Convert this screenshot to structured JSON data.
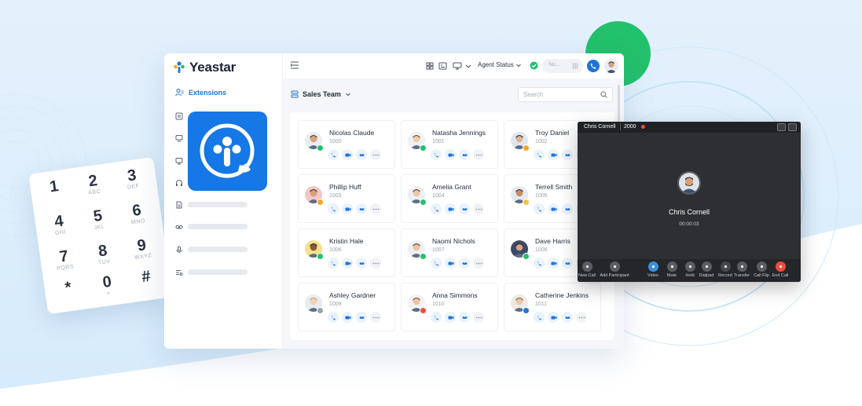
{
  "brand": {
    "name": "Yeastar"
  },
  "keypad": {
    "keys": [
      {
        "digit": "1",
        "letters": ""
      },
      {
        "digit": "2",
        "letters": "ABC"
      },
      {
        "digit": "3",
        "letters": "DEF"
      },
      {
        "digit": "4",
        "letters": "GHI"
      },
      {
        "digit": "5",
        "letters": "JKL"
      },
      {
        "digit": "6",
        "letters": "MNO"
      },
      {
        "digit": "7",
        "letters": "PQRS"
      },
      {
        "digit": "8",
        "letters": "TUV"
      },
      {
        "digit": "9",
        "letters": "WXYZ"
      },
      {
        "digit": "*",
        "letters": ""
      },
      {
        "digit": "0",
        "letters": "+"
      },
      {
        "digit": "#",
        "letters": ""
      }
    ]
  },
  "sidebar": {
    "active_label": "Extensions",
    "icons": [
      "contacts-icon",
      "monitor-icon",
      "display-icon",
      "headset-icon",
      "document-icon",
      "voicemail-icon",
      "microphone-icon",
      "list-settings-icon"
    ]
  },
  "topbar": {
    "agent_status": "Agent Status",
    "number_placeholder": "Nu..."
  },
  "main": {
    "team": "Sales Team",
    "search_placeholder": "Search",
    "contacts": [
      {
        "name": "Nicolas Claude",
        "ext": "1000",
        "status": "#22c16b",
        "skin": "#d8a47e",
        "hair": "#4a3424",
        "bg": "#e9eef5"
      },
      {
        "name": "Natasha Jennings",
        "ext": "1001",
        "status": "#22c16b",
        "skin": "#f0c9a8",
        "hair": "#6b4a33",
        "bg": "#eef1f4"
      },
      {
        "name": "Troy Daniel",
        "ext": "1002",
        "status": "#f5a623",
        "skin": "#e2b08c",
        "hair": "#2f2a26",
        "bg": "#dde6f0"
      },
      {
        "name": "Phillip Huff",
        "ext": "1003",
        "status": "#f5a623",
        "skin": "#d7a07c",
        "hair": "#3a2a20",
        "bg": "#f3c7c7"
      },
      {
        "name": "Amelia Grant",
        "ext": "1004",
        "status": "#22c16b",
        "skin": "#efc4a4",
        "hair": "#5a3a26",
        "bg": "#eceff3"
      },
      {
        "name": "Terrell Smith",
        "ext": "1005",
        "status": "#f5c242",
        "skin": "#c98e66",
        "hair": "#2e2520",
        "bg": "#e4eaf1"
      },
      {
        "name": "Kristin Hale",
        "ext": "1006",
        "status": "#22c16b",
        "skin": "#8a5a3c",
        "hair": "#2a1b14",
        "bg": "#f6e08a"
      },
      {
        "name": "Naomi Nichols",
        "ext": "1007",
        "status": "#22c16b",
        "skin": "#eec2a0",
        "hair": "#5b3a28",
        "bg": "#eef0f3"
      },
      {
        "name": "Dave Harris",
        "ext": "1008",
        "status": "#22c16b",
        "skin": "#d9a582",
        "hair": "#332820",
        "bg": "#3b4a66"
      },
      {
        "name": "Ashley Gardner",
        "ext": "1009",
        "status": "#9aa3ad",
        "skin": "#f1d1b7",
        "hair": "#c99a5c",
        "bg": "#e6ecf2"
      },
      {
        "name": "Anna Simmons",
        "ext": "1010",
        "status": "#ef4b3f",
        "skin": "#efc3a4",
        "hair": "#6a4430",
        "bg": "#f0f2f4"
      },
      {
        "name": "Catherine Jenkins",
        "ext": "1011",
        "status": "#1e74d6",
        "skin": "#eec6a8",
        "hair": "#7a5234",
        "bg": "#ede9e4"
      }
    ]
  },
  "call_window": {
    "caller": "Chris Cornell",
    "number": "2000",
    "timer": "00:00:03",
    "controls": [
      {
        "label": "New Call",
        "icon": "plus-icon",
        "color": "#5a5d62"
      },
      {
        "label": "Add Participant",
        "icon": "add-participant-icon",
        "color": "#5a5d62"
      },
      {
        "label": "Video",
        "icon": "video-icon",
        "color": "#3c8fe0"
      },
      {
        "label": "Mute",
        "icon": "mute-icon",
        "color": "#5a5d62"
      },
      {
        "label": "Hold",
        "icon": "hold-icon",
        "color": "#5a5d62"
      },
      {
        "label": "Dialpad",
        "icon": "dialpad-icon",
        "color": "#5a5d62"
      },
      {
        "label": "Record",
        "icon": "record-icon",
        "color": "#45484d"
      },
      {
        "label": "Transfer",
        "icon": "transfer-icon",
        "color": "#5a5d62"
      },
      {
        "label": "Call Flip",
        "icon": "call-flip-icon",
        "color": "#5a5d62"
      },
      {
        "label": "End Call",
        "icon": "end-call-icon",
        "color": "#ef4b3f"
      }
    ]
  },
  "colors": {
    "accent": "#1e74d6",
    "green": "#22c16b"
  }
}
